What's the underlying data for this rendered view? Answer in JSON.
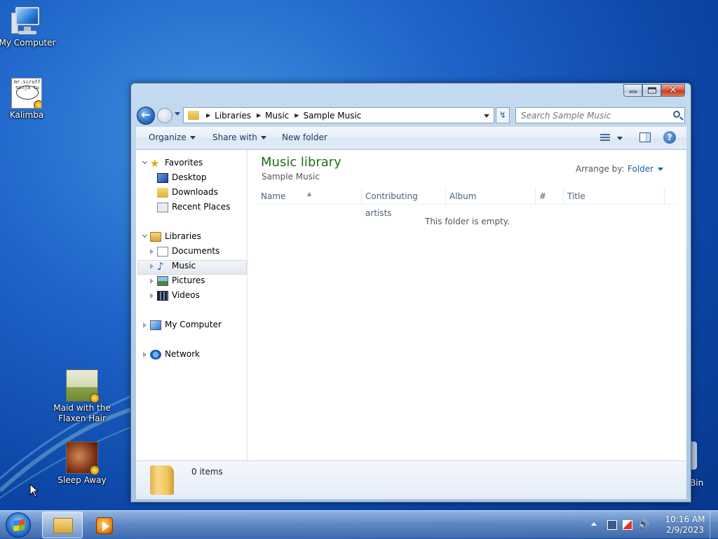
{
  "desktop": {
    "icons": [
      {
        "label": "My Computer"
      },
      {
        "label": "Kalimba",
        "art_text": "mr.scruff ninja tu"
      },
      {
        "label": "Maid with the Flaxen Hair"
      },
      {
        "label": "Sleep Away"
      }
    ],
    "recycle_bin_partial_label": "Bin"
  },
  "window": {
    "breadcrumb": [
      "Libraries",
      "Music",
      "Sample Music"
    ],
    "search_placeholder": "Search Sample Music",
    "toolbar": {
      "organize": "Organize",
      "share_with": "Share with",
      "new_folder": "New folder",
      "help": "?"
    },
    "nav": {
      "favorites": "Favorites",
      "favorites_items": [
        "Desktop",
        "Downloads",
        "Recent Places"
      ],
      "libraries": "Libraries",
      "libraries_items": [
        "Documents",
        "Music",
        "Pictures",
        "Videos"
      ],
      "selected": "Music",
      "my_computer": "My Computer",
      "network": "Network"
    },
    "library": {
      "title": "Music library",
      "subtitle": "Sample Music",
      "arrange_label": "Arrange by:",
      "arrange_value": "Folder"
    },
    "columns": [
      "Name",
      "Contributing artists",
      "Album",
      "#",
      "Title"
    ],
    "empty_message": "This folder is empty.",
    "details_count": "0 items"
  },
  "taskbar": {
    "time": "10:16 AM",
    "date": "2/9/2023"
  },
  "colors": {
    "library_title": "#1e6e18",
    "link_blue": "#1a5fb4",
    "desktop_blue": "#1e64c8"
  }
}
